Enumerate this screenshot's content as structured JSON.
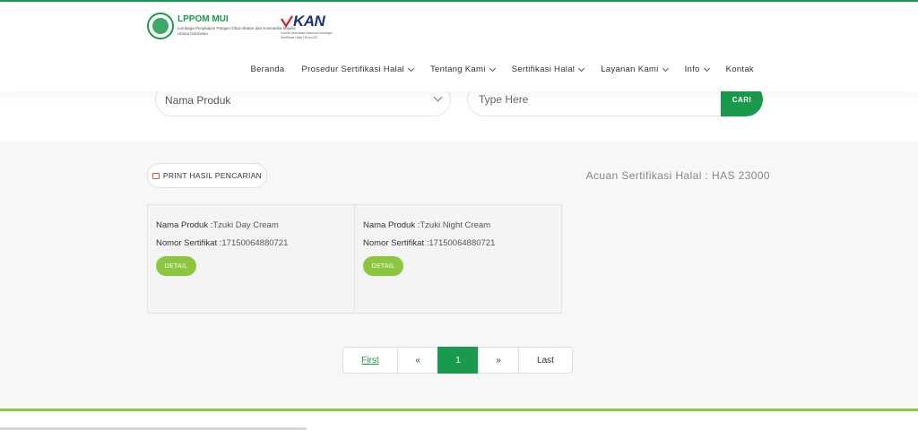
{
  "header": {
    "lppom_title": "LPPOM MUI",
    "lppom_subtitle": "Lembaga Pengkajian Pangan Obat-obatan dan Kosmetika Majelis Ulama Indonesia",
    "kan_title": "KAN",
    "kan_subtitle": "Komite Akreditasi Nasional Lembaga Sertifikasi Halal LSHal-001"
  },
  "nav": {
    "items": [
      {
        "label": "Beranda",
        "dropdown": false
      },
      {
        "label": "Prosedur Sertifikasi Halal",
        "dropdown": true
      },
      {
        "label": "Tentang Kami",
        "dropdown": true
      },
      {
        "label": "Sertifikasi Halal",
        "dropdown": true
      },
      {
        "label": "Layanan Kami",
        "dropdown": true
      },
      {
        "label": "Info",
        "dropdown": true
      },
      {
        "label": "Kontak",
        "dropdown": false
      }
    ]
  },
  "search": {
    "select_value": "Nama Produk",
    "input_placeholder": "Type Here",
    "button_label": "CARI"
  },
  "results": {
    "print_label": "PRINT HASIL PENCARIAN",
    "acuan": "Acuan Sertifikasi Halal : HAS 23000",
    "cards": [
      {
        "product_label": "Nama Produk :",
        "product": "Tzuki Day Cream",
        "cert_label": "Nomor Sertifikat :",
        "cert": "17150064880721",
        "detail_label": "DETAIL"
      },
      {
        "product_label": "Nama Produk :",
        "product": "Tzuki Night Cream",
        "cert_label": "Nomor Sertifikat :",
        "cert": "17150064880721",
        "detail_label": "DETAIL"
      }
    ]
  },
  "pagination": {
    "first": "First",
    "prev": "«",
    "current": "1",
    "next": "»",
    "last": "Last"
  },
  "colors": {
    "brand_green": "#1a9a4c",
    "light_green": "#8cc63f",
    "kan_blue": "#1f2f7a"
  }
}
